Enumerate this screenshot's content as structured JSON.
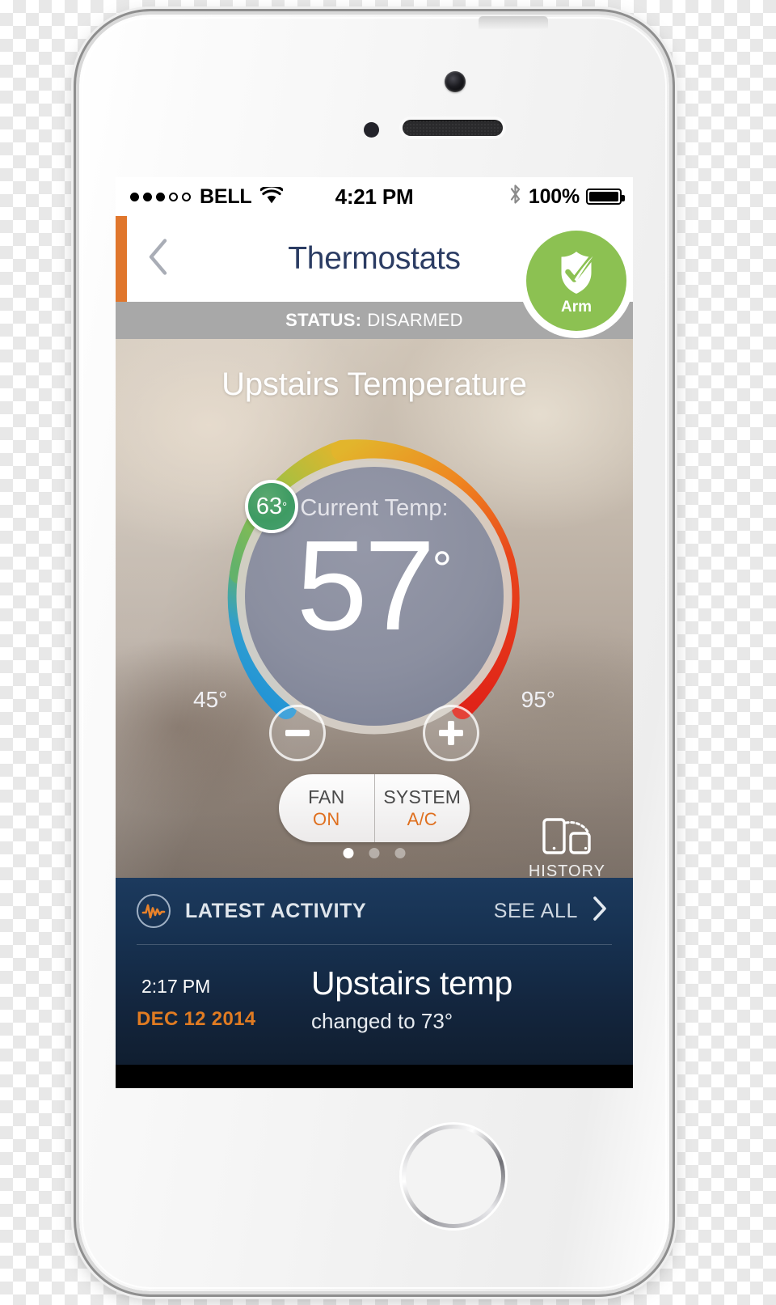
{
  "statusbar": {
    "carrier": "BELL",
    "signal_filled": 3,
    "signal_total": 5,
    "wifi_icon": "wifi-icon",
    "time": "4:21 PM",
    "bluetooth_icon": "bluetooth-icon",
    "battery_percent": "100%",
    "battery_icon": "battery-full-icon"
  },
  "navbar": {
    "back_icon": "chevron-left-icon",
    "title": "Thermostats",
    "arm_label": "Arm",
    "arm_icon": "shield-check-icon",
    "accent_color": "#e0762c",
    "arm_color": "#8cc152",
    "title_color": "#2b3c63"
  },
  "status_strip": {
    "label": "STATUS:",
    "value": "DISARMED"
  },
  "thermostat": {
    "title": "Upstairs Temperature",
    "current_label": "Current Temp:",
    "current_temp": "57",
    "degree": "°",
    "min_tick": "45°",
    "max_tick": "95°",
    "setpoint": "63",
    "setpoint_degree": "°",
    "minus_icon": "minus-icon",
    "plus_icon": "plus-icon",
    "fan": {
      "label": "FAN",
      "value": "ON"
    },
    "system": {
      "label": "SYSTEM",
      "value": "A/C"
    },
    "history": {
      "label": "HISTORY",
      "icon": "device-rotate-icon"
    },
    "page_dots": {
      "count": 3,
      "active_index": 0
    },
    "arc_colors": {
      "cold": "#1d8fd8",
      "cool": "#3fa9c8",
      "green": "#8cbf45",
      "yellow": "#f0b323",
      "orange": "#ee7b22",
      "hot": "#e02318"
    },
    "dial_face_color": "#8b8fa0",
    "setpoint_color": "#449c66"
  },
  "activity": {
    "icon": "activity-pulse-icon",
    "title": "LATEST ACTIVITY",
    "see_all": "SEE ALL",
    "see_all_icon": "chevron-right-icon",
    "accent_color": "#e07b22",
    "items": [
      {
        "time": "2:17",
        "meridiem": "PM",
        "date": "DEC 12 2014",
        "title": "Upstairs temp",
        "detail": "changed to 73°"
      }
    ]
  }
}
